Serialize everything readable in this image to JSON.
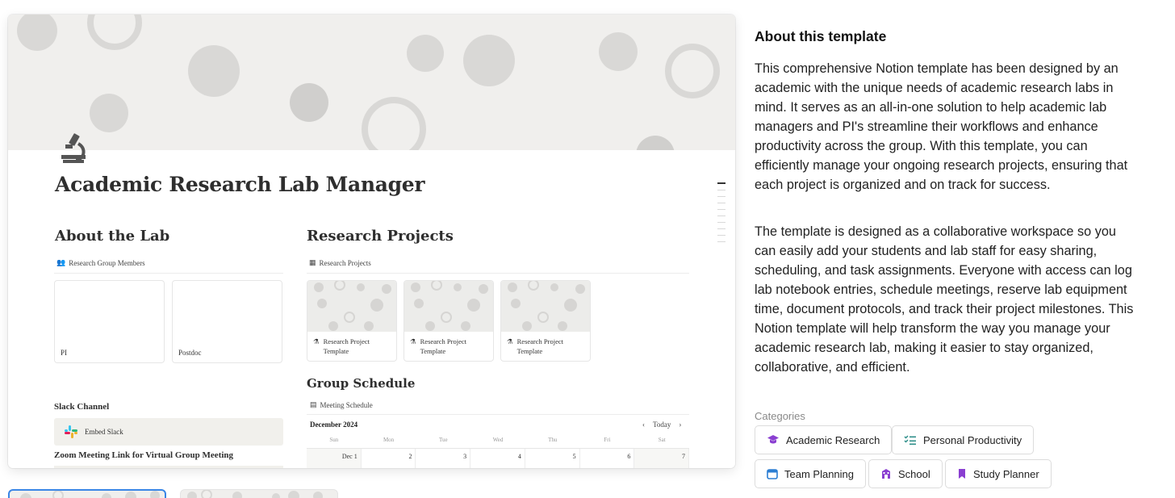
{
  "preview": {
    "page_title": "Academic Research Lab Manager",
    "about_lab": {
      "heading": "About the Lab",
      "db_label": "Research Group Members",
      "members": [
        "PI",
        "Postdoc"
      ],
      "slack_heading": "Slack Channel",
      "slack_embed": "Embed Slack",
      "zoom_heading": "Zoom Meeting Link for Virtual Group Meeting"
    },
    "research": {
      "heading": "Research Projects",
      "db_label": "Research Projects",
      "cards": [
        "Research Project Template",
        "Research Project Template",
        "Research Project Template"
      ]
    },
    "schedule": {
      "heading": "Group Schedule",
      "db_label": "Meeting Schedule",
      "month": "December 2024",
      "today": "Today",
      "weekdays": [
        "Sun",
        "Mon",
        "Tue",
        "Wed",
        "Thu",
        "Fri",
        "Sat"
      ],
      "days": [
        "Dec 1",
        "2",
        "3",
        "4",
        "5",
        "6",
        "7"
      ]
    }
  },
  "about": {
    "title": "About this template",
    "paragraphs": [
      "This comprehensive Notion template has been designed by an academic with the unique needs of academic research labs in mind. It serves as an all-in-one solution to help academic lab managers and PI's streamline their workflows and enhance productivity across the group. With this template, you can efficiently manage your ongoing research projects, ensuring that each project is organized and on track for success.",
      "The template is designed as a collaborative workspace so you can easily add your students and lab staff for easy sharing, scheduling, and task assignments. Everyone with access can log lab notebook entries, schedule meetings, reserve lab equipment time, document protocols, and track their project milestones. This Notion template will help transform the way you manage your academic research lab, making it easier to stay organized, collaborative, and efficient."
    ]
  },
  "categories": {
    "label": "Categories",
    "items": [
      {
        "label": "Academic Research",
        "icon": "graduation-cap-icon",
        "color": "#8a3fd1"
      },
      {
        "label": "Personal Productivity",
        "icon": "checklist-icon",
        "color": "#2f8f8a"
      },
      {
        "label": "Team Planning",
        "icon": "calendar-icon",
        "color": "#2d7fd3"
      },
      {
        "label": "School",
        "icon": "school-icon",
        "color": "#8a3fd1"
      },
      {
        "label": "Study Planner",
        "icon": "bookmark-icon",
        "color": "#8a3fd1"
      }
    ]
  }
}
